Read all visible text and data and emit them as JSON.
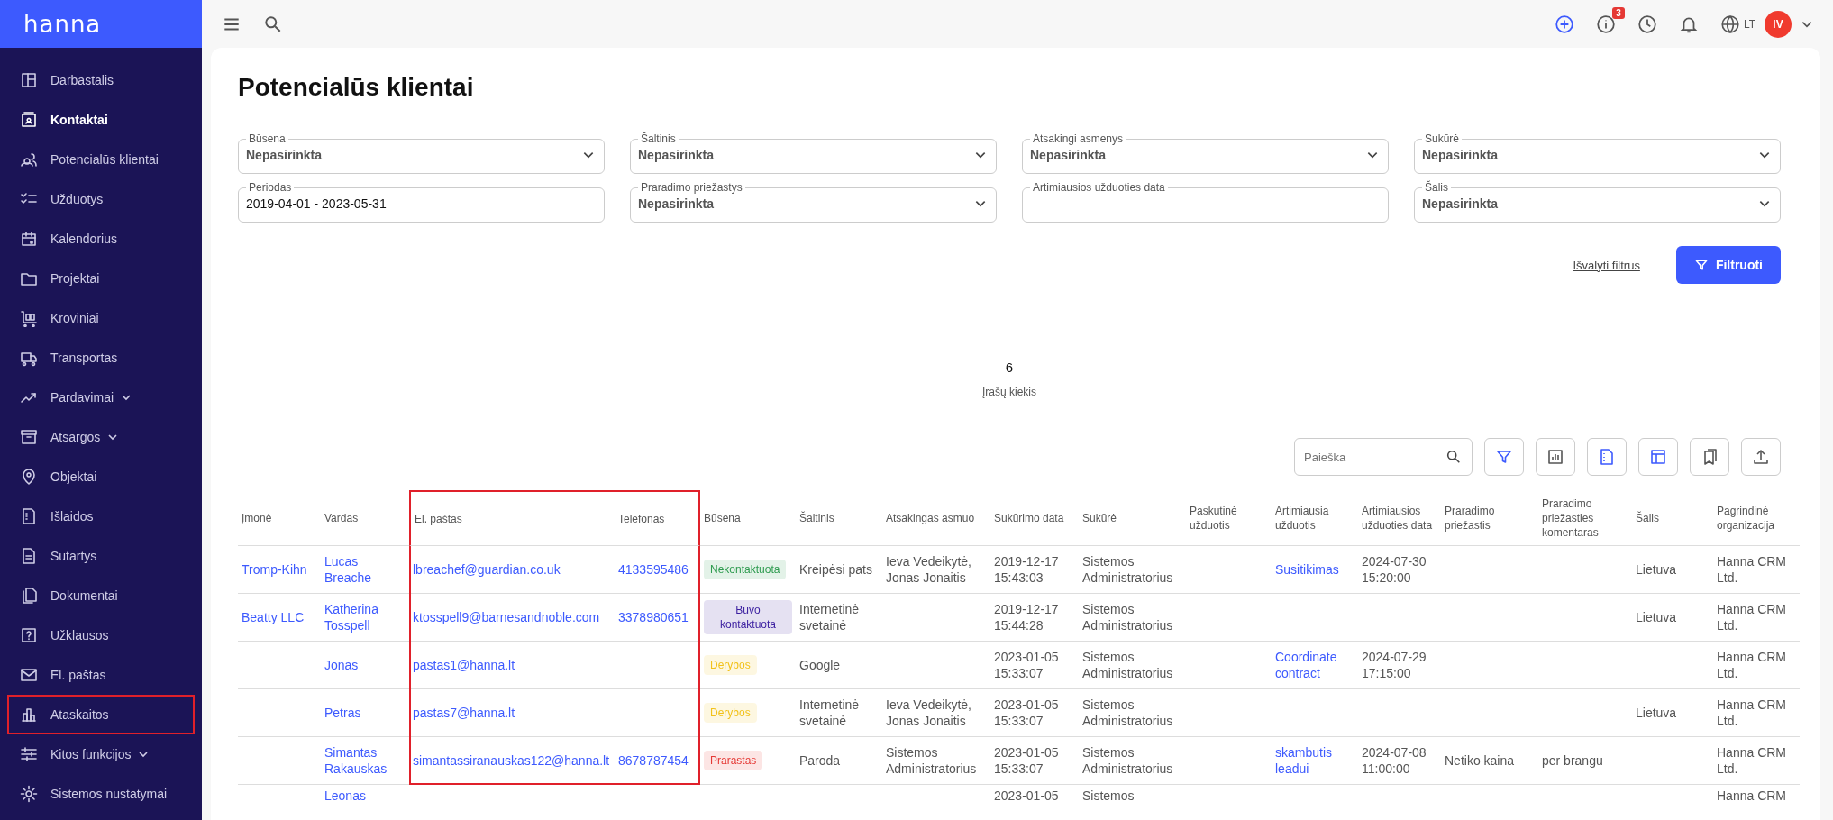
{
  "sidebar": {
    "logo": "hanna",
    "items": [
      {
        "label": "Darbastalis",
        "selected": false,
        "has_submenu": false,
        "highlighted": false
      },
      {
        "label": "Kontaktai",
        "selected": true,
        "has_submenu": false,
        "highlighted": false
      },
      {
        "label": "Potencialūs klientai",
        "selected": false,
        "has_submenu": false,
        "highlighted": false
      },
      {
        "label": "Užduotys",
        "selected": false,
        "has_submenu": false,
        "highlighted": false
      },
      {
        "label": "Kalendorius",
        "selected": false,
        "has_submenu": false,
        "highlighted": false
      },
      {
        "label": "Projektai",
        "selected": false,
        "has_submenu": false,
        "highlighted": false
      },
      {
        "label": "Kroviniai",
        "selected": false,
        "has_submenu": false,
        "highlighted": false
      },
      {
        "label": "Transportas",
        "selected": false,
        "has_submenu": false,
        "highlighted": false
      },
      {
        "label": "Pardavimai",
        "selected": false,
        "has_submenu": true,
        "highlighted": false
      },
      {
        "label": "Atsargos",
        "selected": false,
        "has_submenu": true,
        "highlighted": false
      },
      {
        "label": "Objektai",
        "selected": false,
        "has_submenu": false,
        "highlighted": false
      },
      {
        "label": "Išlaidos",
        "selected": false,
        "has_submenu": false,
        "highlighted": false
      },
      {
        "label": "Sutartys",
        "selected": false,
        "has_submenu": false,
        "highlighted": false
      },
      {
        "label": "Dokumentai",
        "selected": false,
        "has_submenu": false,
        "highlighted": false
      },
      {
        "label": "Užklausos",
        "selected": false,
        "has_submenu": false,
        "highlighted": false
      },
      {
        "label": "El. paštas",
        "selected": false,
        "has_submenu": false,
        "highlighted": false
      },
      {
        "label": "Ataskaitos",
        "selected": false,
        "has_submenu": false,
        "highlighted": true
      },
      {
        "label": "Kitos funkcijos",
        "selected": false,
        "has_submenu": true,
        "highlighted": false
      },
      {
        "label": "Sistemos nustatymai",
        "selected": false,
        "has_submenu": false,
        "highlighted": false
      }
    ]
  },
  "topbar": {
    "notification_count": "3",
    "language": "LT",
    "avatar_initials": "IV"
  },
  "page_title": "Potencialūs klientai",
  "filters": [
    {
      "label": "Būsena",
      "value": "Nepasirinkta",
      "kind": "select"
    },
    {
      "label": "Šaltinis",
      "value": "Nepasirinkta",
      "kind": "select"
    },
    {
      "label": "Atsakingi asmenys",
      "value": "Nepasirinkta",
      "kind": "select"
    },
    {
      "label": "Sukūrė",
      "value": "Nepasirinkta",
      "kind": "select"
    },
    {
      "label": "Periodas",
      "value": "2019-04-01 - 2023-05-31",
      "kind": "date"
    },
    {
      "label": "Praradimo priežastys",
      "value": "Nepasirinkta",
      "kind": "select"
    },
    {
      "label": "Artimiausios užduoties data",
      "kind": "date"
    },
    {
      "label": "Šalis",
      "value": "Nepasirinkta",
      "kind": "select"
    }
  ],
  "clear_filters": "Išvalyti filtrus",
  "filter_button": "Filtruoti",
  "record_count": "6",
  "record_count_label": "Įrašų kiekis",
  "search": {
    "placeholder": "Paieška"
  },
  "table": {
    "columns": [
      {
        "label": "Įmonė",
        "kind": "link",
        "highlighted": false
      },
      {
        "label": "Vardas",
        "kind": "link",
        "highlighted": false
      },
      {
        "label": "El. paštas",
        "kind": "link",
        "highlighted": true
      },
      {
        "label": "Telefonas",
        "kind": "link",
        "highlighted": true
      },
      {
        "label": "Būsena",
        "kind": "badge",
        "highlighted": false
      },
      {
        "label": "Šaltinis",
        "kind": "text",
        "highlighted": false
      },
      {
        "label": "Atsakingas asmuo",
        "kind": "text",
        "highlighted": false
      },
      {
        "label": "Sukūrimo data",
        "kind": "text",
        "highlighted": false
      },
      {
        "label": "Sukūrė",
        "kind": "text",
        "highlighted": false
      },
      {
        "label": "Paskutinė užduotis",
        "highlighted": false
      },
      {
        "label": "Artimiausia užduotis",
        "kind": "link",
        "highlighted": false
      },
      {
        "label": "Artimiausios užduoties data",
        "kind": "text",
        "highlighted": false
      },
      {
        "label": "Praradimo priežastis",
        "kind": "text",
        "highlighted": false
      },
      {
        "label": "Praradimo priežasties komentaras",
        "kind": "text",
        "highlighted": false
      },
      {
        "label": "Šalis",
        "kind": "text",
        "highlighted": false
      },
      {
        "label": "Pagrindinė organizacija",
        "kind": "text",
        "highlighted": false
      }
    ],
    "rows": [
      {
        "color": "#2e9b4f",
        "cells": [
          "Tromp-Kihn",
          "Lucas Breache",
          "lbreachef@guardian.co.uk",
          "4133595486",
          "Nekontaktuota",
          "Kreipėsi pats",
          "Ieva Vedeikytė, Jonas Jonaitis",
          "2019-12-17 15:43:03",
          "Sistemos Administratorius",
          null,
          "Susitikimas",
          "2024-07-30 15:20:00",
          null,
          null,
          "Lietuva",
          "Hanna CRM Ltd."
        ]
      },
      {
        "color": "#3b1fa0",
        "cells": [
          "Beatty LLC",
          "Katherina Tosspell",
          "ktosspell9@barnesandnoble.com",
          "3378980651",
          "Buvo kontaktuota",
          "Internetinė svetainė",
          null,
          "2019-12-17 15:44:28",
          "Sistemos Administratorius",
          null,
          null,
          null,
          null,
          null,
          "Lietuva",
          "Hanna CRM Ltd."
        ]
      },
      {
        "color": "#f2c21b",
        "cells": [
          null,
          "Jonas",
          "pastas1@hanna.lt",
          null,
          "Derybos",
          "Google",
          null,
          "2023-01-05 15:33:07",
          "Sistemos Administratorius",
          null,
          "Coordinate contract",
          "2024-07-29 17:15:00",
          null,
          null,
          null,
          "Hanna CRM Ltd."
        ]
      },
      {
        "color": "#f2c21b",
        "cells": [
          null,
          "Petras",
          "pastas7@hanna.lt",
          null,
          "Derybos",
          "Internetinė svetainė",
          "Ieva Vedeikytė, Jonas Jonaitis",
          "2023-01-05 15:33:07",
          "Sistemos Administratorius",
          null,
          null,
          null,
          null,
          null,
          "Lietuva",
          "Hanna CRM Ltd."
        ]
      },
      {
        "color": "#e53935",
        "cells": [
          null,
          "Simantas Rakauskas",
          "simantassiranauskas122@hanna.lt",
          "8678787454",
          "Prarastas",
          "Paroda",
          "Sistemos Administratorius",
          "2023-01-05 15:33:07",
          "Sistemos Administratorius",
          null,
          "skambutis leadui",
          "2024-07-08 11:00:00",
          "Netiko kaina",
          "per brangu",
          null,
          "Hanna CRM Ltd."
        ]
      },
      {
        "cells": [
          null,
          "Leonas",
          null,
          null,
          null,
          null,
          null,
          "2023-01-05",
          "Sistemos",
          null,
          null,
          null,
          null,
          null,
          null,
          "Hanna CRM"
        ]
      }
    ]
  }
}
